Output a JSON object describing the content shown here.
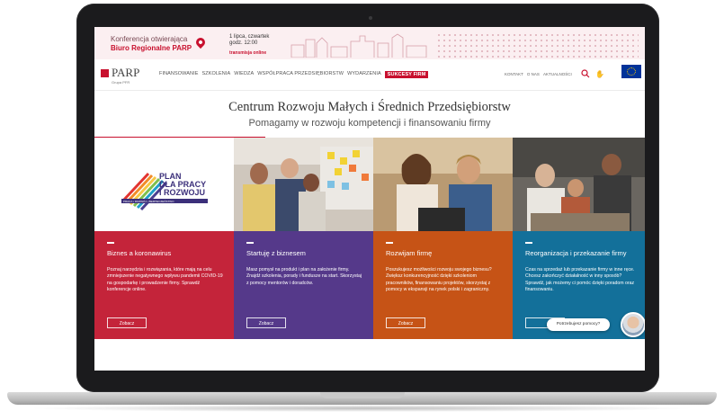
{
  "banner": {
    "line1": "Konferencja otwierająca",
    "line2": "Biuro Regionalne PARP",
    "date_line1": "1 lipca, czwartek",
    "date_line2": "godz. 12:00",
    "transmission": "transmisja online"
  },
  "nav": {
    "logo": "PARP",
    "logo_sub": "Grupa PFR",
    "menu": [
      "FINANSOWANIE",
      "SZKOLENIA",
      "WIEDZA",
      "WSPÓŁPRACA PRZEDSIĘBIORSTW",
      "WYDARZENIA",
      "SUKCESY FIRM"
    ],
    "right": [
      "KONTAKT",
      "O NAS",
      "AKTUALNOŚCI"
    ]
  },
  "hero": {
    "title": "Centrum Rozwoju Małych i Średnich Przedsiębiorstw",
    "subtitle": "Pomagamy w rozwoju kompetencji i finansowaniu firmy"
  },
  "plan": {
    "line1": "PLAN",
    "line2": "DLA PRACY",
    "line3": "I ROZWOJU",
    "tag": "PRACA • ROZWÓJ • BEZPIECZEŃSTWO"
  },
  "cards": [
    {
      "title": "Biznes a koronawirus",
      "desc": "Poznaj narzędzia i rozwiązania, które mają na celu zmniejszenie negatywnego wpływu pandemii COVID-19 na gospodarkę i prowadzenie firmy. Sprawdź konferencje online.",
      "button": "Zobacz",
      "color": "#c4243a"
    },
    {
      "title": "Startuję z biznesem",
      "desc": "Masz pomysł na produkt i plan na założenie firmy. Znajdź szkolenia, porady i fundusze na start. Skorzystaj z pomocy mentorów i doradców.",
      "button": "Zobacz",
      "color": "#55398a"
    },
    {
      "title": "Rozwijam firmę",
      "desc": "Poszukujesz możliwości rozwoju swojego biznesu? Zwiększ konkurencyjność dzięki szkoleniom pracowników, finansowaniu projektów, skorzystaj z pomocy w ekspansji na rynek polski i zagraniczny.",
      "button": "Zobacz",
      "color": "#c65316"
    },
    {
      "title": "Reorganizacja i przekazanie firmy",
      "desc": "Czas na sprzedaż lub przekazanie firmy w inne ręce. Chcesz zakończyć działalność w inny sposób? Sprawdź, jak możemy ci pomóc dzięki poradom oraz finansowaniu.",
      "button": "",
      "color": "#13709a"
    }
  ],
  "chat": {
    "label": "Potrzebujesz pomocy?"
  },
  "colors": {
    "brand_red": "#c8102e",
    "laptop_bezel": "#1b1b1d"
  }
}
